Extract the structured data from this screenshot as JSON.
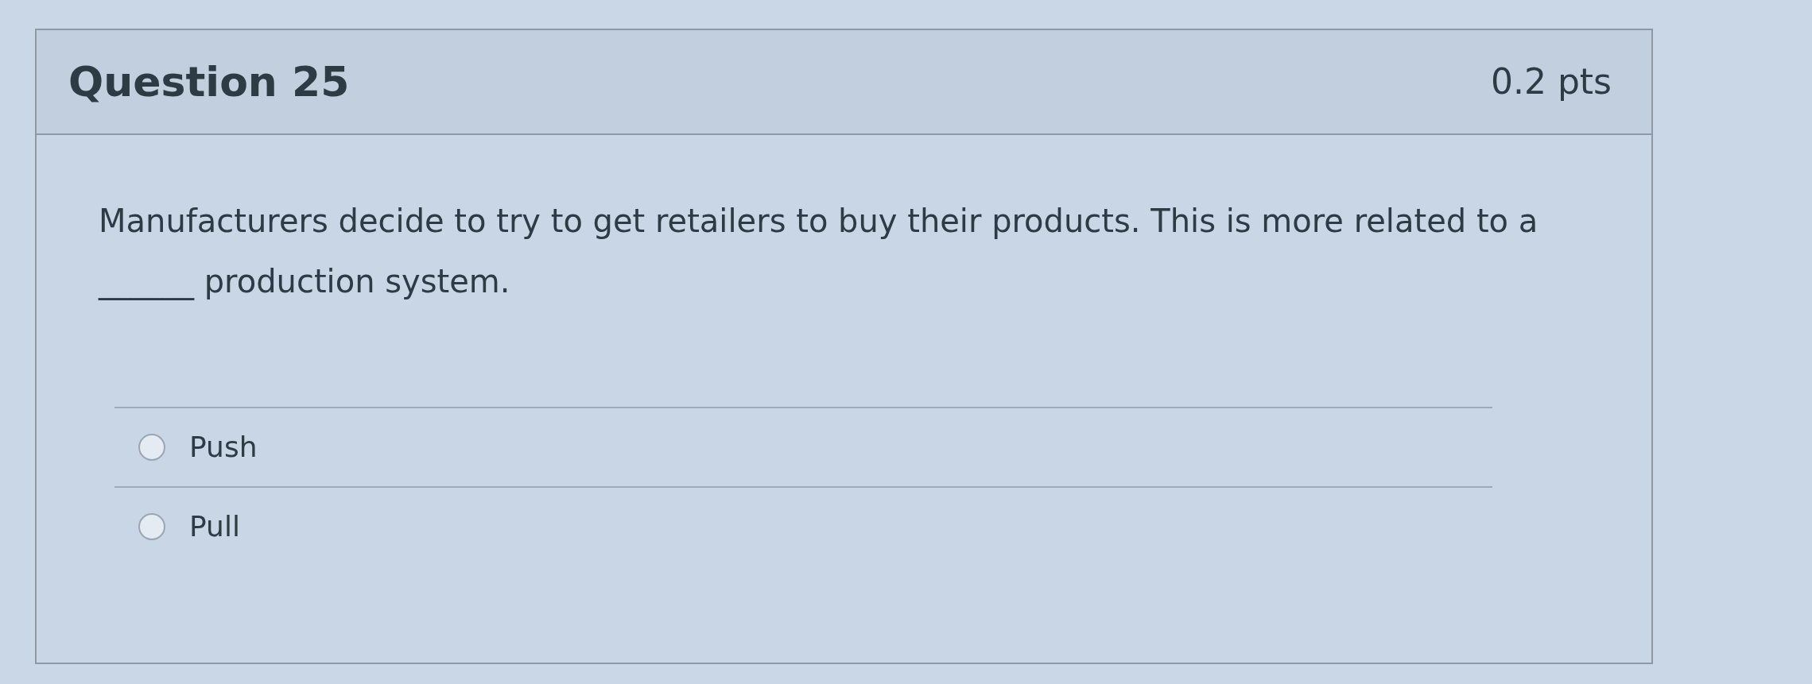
{
  "question": {
    "title": "Question 25",
    "points": "0.2 pts",
    "text": "Manufacturers decide to try to get retailers to buy their products. This is more related to a ______ production system.",
    "answers": [
      {
        "label": "Push",
        "selected": false
      },
      {
        "label": "Pull",
        "selected": false
      }
    ]
  }
}
